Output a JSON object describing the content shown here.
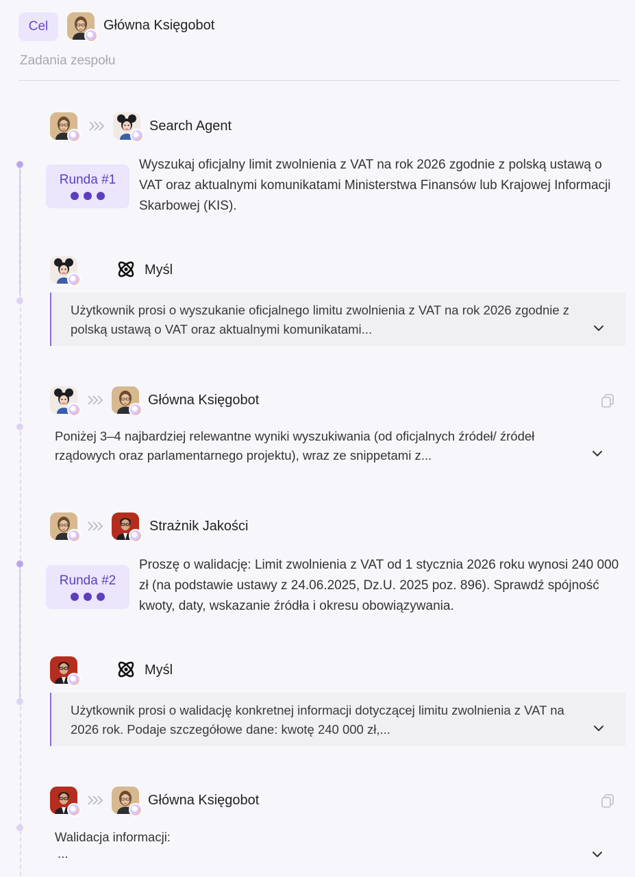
{
  "header": {
    "goal_label": "Cel",
    "agent_name": "Główna Księgobot",
    "subtitle": "Zadania zespołu"
  },
  "steps": [
    {
      "to": "Search Agent",
      "round": "Runda #1",
      "message": "Wyszukaj oficjalny limit zwolnienia z VAT na rok 2026 zgodnie z polską ustawą o VAT oraz aktualnymi komunikatami Ministerstwa Finansów lub Krajowej Informacji Skarbowej (KIS)."
    },
    {
      "thought_label": "Myśl",
      "thought": "Użytkownik prosi o wyszukanie oficjalnego limitu zwolnienia z VAT na rok 2026 zgodnie z polską ustawą o VAT oraz aktualnymi komunikatami..."
    },
    {
      "to": "Główna Księgobot",
      "message": "Poniżej 3–4 najbardziej relewantne wyniki wyszukiwania (od oficjalnych źródeł/ źródeł rządowych oraz parlamentarnego projektu), wraz ze snippetami z..."
    },
    {
      "to": "Strażnik Jakości",
      "round": "Runda #2",
      "message": "Proszę o walidację: Limit zwolnienia z VAT od 1 stycznia 2026 roku wynosi 240 000 zł (na podstawie ustawy z 24.06.2025, Dz.U. 2025 poz. 896). Sprawdź spójność kwoty, daty, wskazanie źródła i okresu obowiązywania."
    },
    {
      "thought_label": "Myśl",
      "thought": "Użytkownik prosi o walidację konkretnej informacji dotyczącej limitu zwolnienia z VAT na 2026 rok. Podaje szczegółowe dane: kwotę 240 000 zł,..."
    },
    {
      "to": "Główna Księgobot",
      "message_title": "Walidacja informacji:",
      "message_more": "..."
    }
  ],
  "colors": {
    "accent": "#5b3fbf",
    "pill_bg": "#ebe6fb",
    "timeline": "#b9a6ea",
    "background": "#f7f6fa"
  },
  "icons": {
    "avatar_badge": "avatar-status-icon",
    "handoff": "double-chevron-right-icon",
    "thought": "atom-icon",
    "expand": "chevron-down-icon",
    "copy": "copy-icon"
  }
}
